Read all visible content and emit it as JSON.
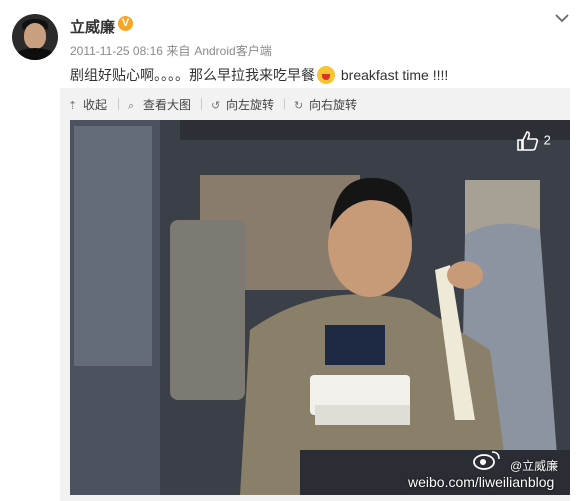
{
  "user": {
    "name": "立威廉",
    "verified_badge": "V"
  },
  "post": {
    "timestamp": "2011-11-25 08:16",
    "source_prefix": "来自",
    "source": "Android客户端",
    "text_before": "剧组好贴心啊。。。。那么早拉我来吃早餐",
    "text_after": " breakfast  time !!!!",
    "emoji_icon": "laughing-face-icon"
  },
  "toolbar": {
    "collapse": "收起",
    "view_large": "查看大图",
    "rotate_left": "向左旋转",
    "rotate_right": "向右旋转"
  },
  "photo": {
    "like_count": "2",
    "watermark_handle": "@立威廉",
    "watermark_url": "weibo.com/liweilianblog"
  },
  "colors": {
    "badge": "#f6a623",
    "panel": "#f2f2f2"
  }
}
